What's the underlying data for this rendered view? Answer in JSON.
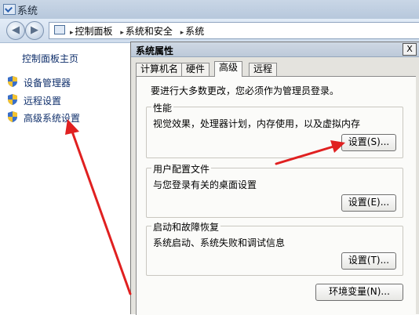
{
  "window": {
    "title": "系统"
  },
  "addressbar": {
    "crumbs": [
      "控制面板",
      "系统和安全",
      "系统"
    ]
  },
  "leftnav": {
    "home": "控制面板主页",
    "items": [
      {
        "label": "设备管理器",
        "icon": "shield-icon"
      },
      {
        "label": "远程设置",
        "icon": "shield-icon"
      },
      {
        "label": "高级系统设置",
        "icon": "shield-icon"
      }
    ]
  },
  "dialog": {
    "title": "系统属性",
    "close": "X",
    "tabs": [
      "计算机名",
      "硬件",
      "高级",
      "远程"
    ],
    "active_tab": "高级",
    "note": "要进行大多数更改，您必须作为管理员登录。",
    "groups": [
      {
        "title": "性能",
        "desc": "视觉效果，处理器计划，内存使用，以及虚拟内存",
        "button": "设置(S)..."
      },
      {
        "title": "用户配置文件",
        "desc": "与您登录有关的桌面设置",
        "button": "设置(E)..."
      },
      {
        "title": "启动和故障恢复",
        "desc": "系统启动、系统失败和调试信息",
        "button": "设置(T)..."
      }
    ],
    "env_button": "环境变量(N)..."
  },
  "colors": {
    "annotation_arrow": "#e02020",
    "dialog_bg": "#e4e3de",
    "link": "#0f2f6b"
  }
}
